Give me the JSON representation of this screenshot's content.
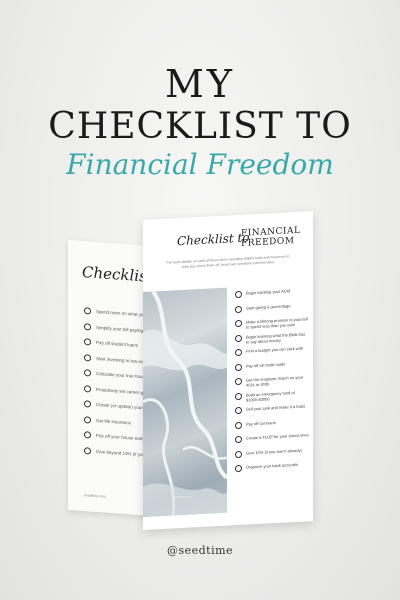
{
  "headline": {
    "line1": "MY",
    "line2": "CHECKLIST TO",
    "script": "Financial Freedom"
  },
  "back_sheet": {
    "title": "Checklist",
    "items": [
      "Spend more on what you love, spending on things you don't",
      "Simplify your bill paying process",
      "Pay off student loans",
      "Start investing in low-cost index a Roth IRA",
      "Calculate your true hourly wage",
      "Proactively set career goals",
      "Create (or update) your will",
      "Get life insurance",
      "Pay off your house early",
      "Give beyond 10% (if you want to)"
    ],
    "footer": "seedtime.com"
  },
  "front_sheet": {
    "title_script": "Checklist to",
    "title_caps": "FINANCIAL FREEDOM",
    "intro": "For more details on each of these items including helpful tools and resources to help you check them off, head over seedtime.com/checklist",
    "photo_caption": "seedtime.com",
    "items": [
      "Begin tracking your AGM",
      "Start giving a percentage",
      "Make a lifelong promise to yourself to spend less than you earn",
      "Begin learning what the Bible has to say about money",
      "Find a budget you can stick with",
      "Pay off all credit cards",
      "Get the employer match on your 401k or 403b",
      "Build an emergency fund of $1000-$3000",
      "Sell your junk and make it a habit",
      "Pay off car loans",
      "Create a FLOP for your bored ones",
      "Give 10% (if you aren't already)",
      "Organize your bank accounts"
    ]
  },
  "handle": "@seedtime",
  "colors": {
    "accent": "#3aa9aa",
    "text": "#1a1a1a"
  }
}
